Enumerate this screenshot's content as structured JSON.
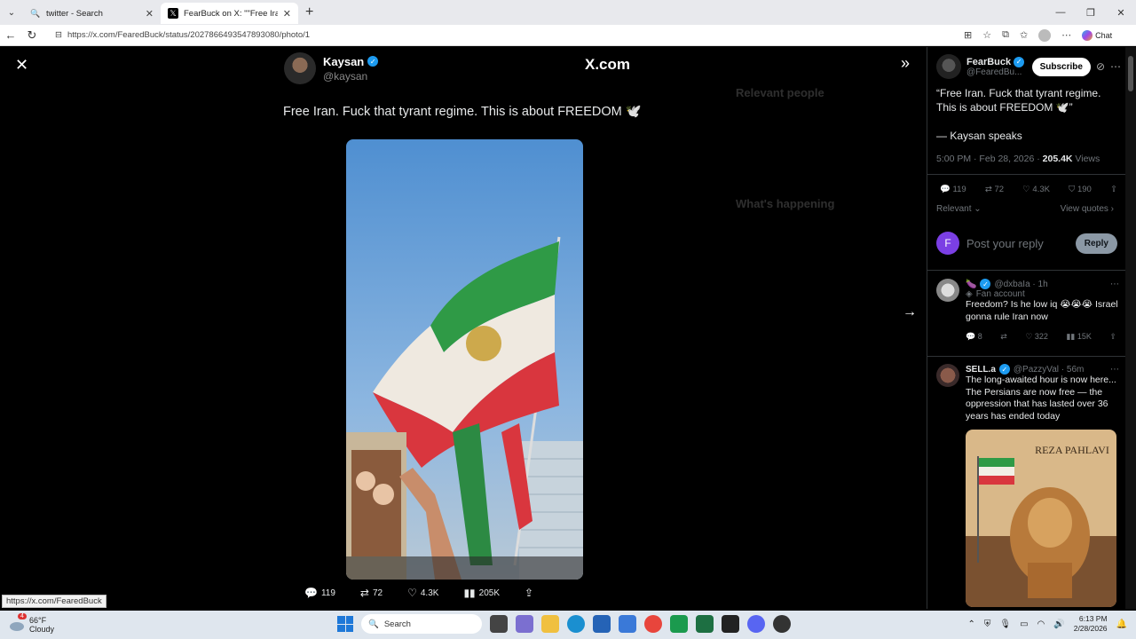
{
  "browser": {
    "tabs": [
      {
        "title": "twitter - Search",
        "active": false
      },
      {
        "title": "FearBuck on X: \"\"Free Iran. Fuck th",
        "active": true
      }
    ],
    "url": "https://x.com/FearedBuck/status/2027866493547893080/photo/1",
    "chat_label": "Chat"
  },
  "viewer": {
    "author_name": "Kaysan",
    "author_handle": "@kaysan",
    "watermark": "X.com",
    "caption": "Free Iran. Fuck that tyrant regime. This is about FREEDOM 🕊️",
    "actions": {
      "replies": "119",
      "reposts": "72",
      "likes": "4.3K",
      "views": "205K"
    },
    "background_panel": {
      "relevant_people": "Relevant people",
      "whats_happening": "What's happening"
    }
  },
  "sidebar": {
    "name": "FearBuck",
    "handle": "@FearedBu...",
    "subscribe_label": "Subscribe",
    "post_text": "“Free Iran. Fuck that tyrant regime. This is about FREEDOM 🕊️”",
    "signature": "— Kaysan speaks",
    "time": "5:00 PM · Feb 28, 2026 · ",
    "views_count": "205.4K",
    "views_label": " Views",
    "stats": {
      "replies": "119",
      "reposts": "72",
      "likes": "4.3K",
      "bookmarks": "190"
    },
    "relevant_label": "Relevant",
    "view_quotes_label": "View quotes",
    "reply_avatar_letter": "F",
    "reply_placeholder": "Post your reply",
    "reply_button": "Reply",
    "replies": [
      {
        "handle": "@dxbaIa · 1h",
        "sub": "Fan account",
        "text": "Freedom? Is he low iq 😭😭😭 Israel gonna rule Iran now",
        "stats": {
          "replies": "8",
          "reposts": "",
          "likes": "322",
          "views": "15K"
        }
      },
      {
        "name": "SELL.a",
        "handle": "@PazzyVal · 56m",
        "text": "The long-awaited hour is now here... The Persians are now free — the oppression that has lasted over 36 years has ended today",
        "image_title": "REZA PAHLAVI"
      }
    ]
  },
  "status_url": "https://x.com/FearedBuck",
  "taskbar": {
    "temp": "66°F",
    "condition": "Cloudy",
    "weather_badge": "4",
    "search_label": "Search",
    "time": "6:13 PM",
    "date": "2/28/2026"
  }
}
